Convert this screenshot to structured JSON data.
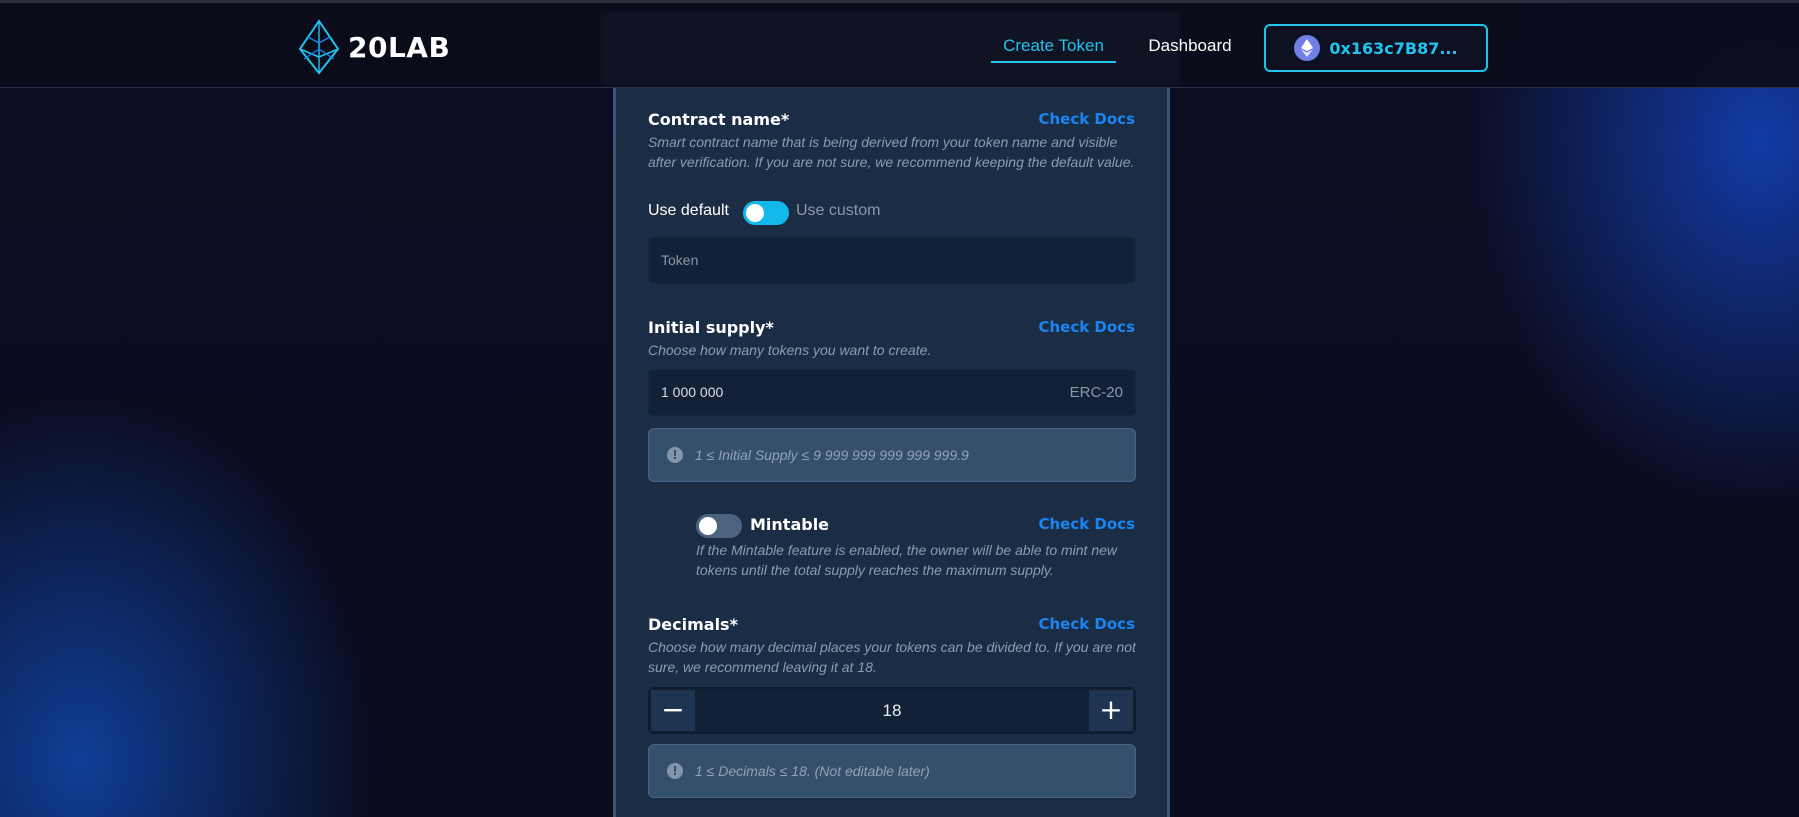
{
  "header": {
    "logo_text": "20LAB",
    "nav": {
      "create_token": "Create Token",
      "dashboard": "Dashboard"
    },
    "wallet_address": "0x163c7B87..."
  },
  "contract_name": {
    "title": "Contract name*",
    "docs_label": "Check Docs",
    "description": "Smart contract name that is being derived from your token name and visible after verification. If you are not sure, we recommend keeping the default value.",
    "toggle_left_label": "Use default",
    "toggle_right_label": "Use custom",
    "toggle_state": "default",
    "input_placeholder": "Token"
  },
  "initial_supply": {
    "title": "Initial supply*",
    "docs_label": "Check Docs",
    "description": "Choose how many tokens you want to create.",
    "value": "1 000 000",
    "suffix": "ERC-20",
    "note": "1 ≤ Initial Supply ≤ 9 999 999 999 999 999.9",
    "note_icon": "!"
  },
  "mintable": {
    "label": "Mintable",
    "docs_label": "Check Docs",
    "enabled": false,
    "description": "If the Mintable feature is enabled, the owner will be able to mint new tokens until the total supply reaches the maximum supply."
  },
  "decimals": {
    "title": "Decimals*",
    "docs_label": "Check Docs",
    "description": "Choose how many decimal places your tokens can be divided to. If you are not sure, we recommend leaving it at 18.",
    "value": "18",
    "minus": "−",
    "plus": "+",
    "note": "1 ≤ Decimals ≤ 18. (Not editable later)",
    "note_icon": "!"
  },
  "colors": {
    "accent": "#22c3ee",
    "link": "#1a85f2",
    "panel": "#1b2d45",
    "note_bg": "#35506d"
  }
}
